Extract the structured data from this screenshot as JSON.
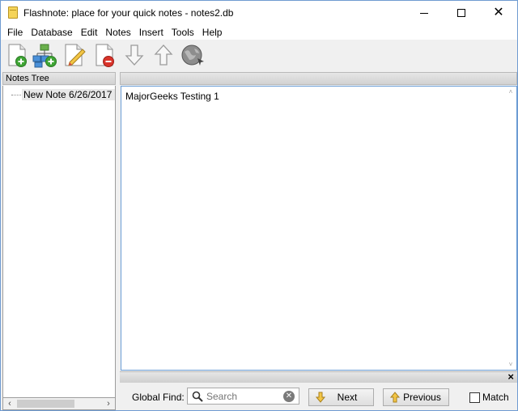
{
  "window": {
    "title": "Flashnote: place for your quick notes - notes2.db",
    "controls": {
      "minimize": "minimize-icon",
      "maximize": "maximize-icon",
      "close": "close-icon"
    }
  },
  "menu": [
    "File",
    "Database",
    "Edit",
    "Notes",
    "Insert",
    "Tools",
    "Help"
  ],
  "toolbar": [
    {
      "name": "add-note-icon"
    },
    {
      "name": "add-subnote-icon"
    },
    {
      "name": "edit-note-icon"
    },
    {
      "name": "delete-note-icon"
    },
    {
      "name": "move-down-icon"
    },
    {
      "name": "move-up-icon"
    },
    {
      "name": "web-icon"
    }
  ],
  "notes_tree": {
    "header": "Notes Tree",
    "items": [
      {
        "label": "New Note 6/26/2017 -"
      }
    ]
  },
  "editor": {
    "content": "MajorGeeks Testing 1"
  },
  "find_bar": {
    "label": "Global Find:",
    "search_placeholder": "Search",
    "next_label": "Next",
    "previous_label": "Previous",
    "match_label": "Match",
    "close": "×"
  },
  "colors": {
    "accent_border": "#6a9dd6",
    "arrow_yellow": "#f3c645"
  }
}
